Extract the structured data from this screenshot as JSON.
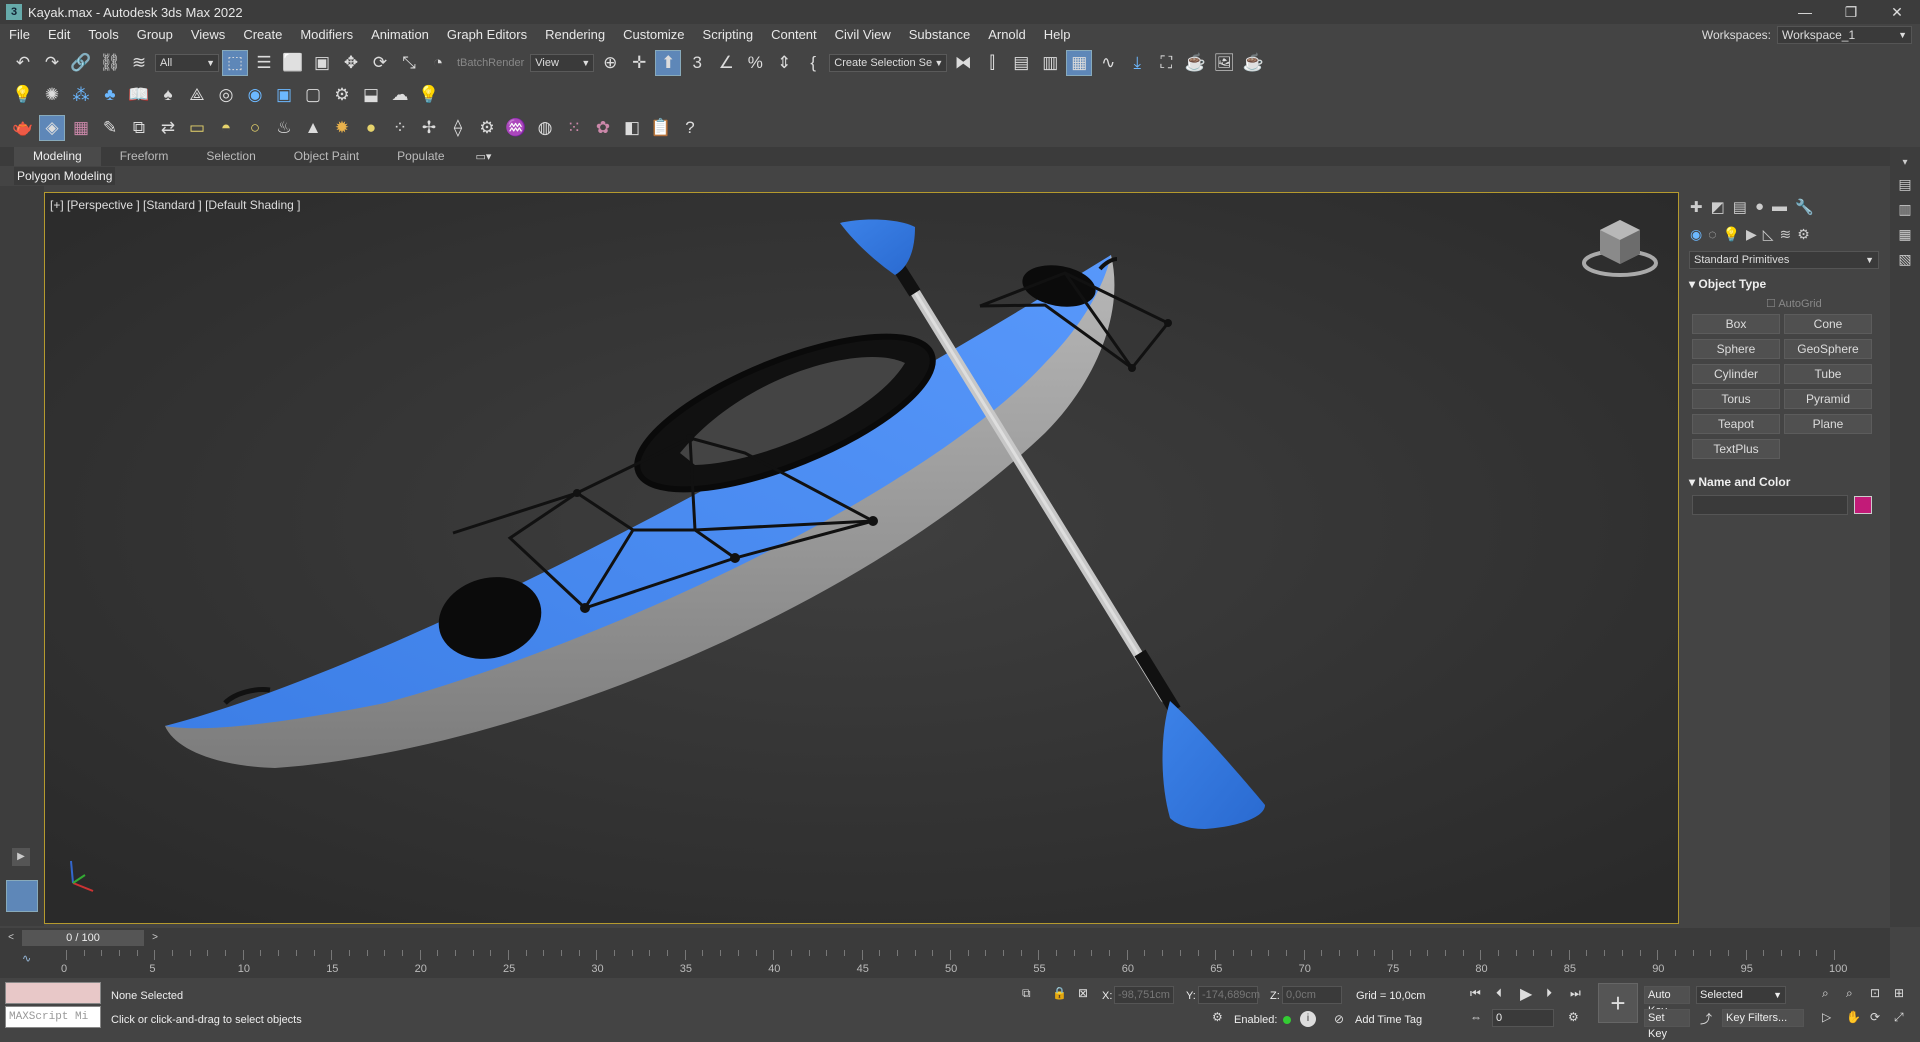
{
  "app": {
    "title": "Kayak.max - Autodesk 3ds Max 2022",
    "window_controls": [
      "—",
      "❐",
      "✕"
    ]
  },
  "menu": {
    "items": [
      "File",
      "Edit",
      "Tools",
      "Group",
      "Views",
      "Create",
      "Modifiers",
      "Animation",
      "Graph Editors",
      "Rendering",
      "Customize",
      "Scripting",
      "Content",
      "Civil View",
      "Substance",
      "Arnold",
      "Help"
    ],
    "workspaces_label": "Workspaces:",
    "workspace_value": "Workspace_1"
  },
  "toolbar": {
    "selection_filter": "All",
    "batch_render": "tBatchRender",
    "ref_coord": "View",
    "selection_set": "Create Selection Se"
  },
  "ribbon": {
    "tabs": [
      "Modeling",
      "Freeform",
      "Selection",
      "Object Paint",
      "Populate"
    ],
    "sub_label": "Polygon Modeling"
  },
  "viewport": {
    "label": "[+] [Perspective ] [Standard ] [Default Shading ]"
  },
  "command_panel": {
    "category": "Standard Primitives",
    "object_type_header": "Object Type",
    "autogrid": "AutoGrid",
    "buttons": [
      "Box",
      "Cone",
      "Sphere",
      "GeoSphere",
      "Cylinder",
      "Tube",
      "Torus",
      "Pyramid",
      "Teapot",
      "Plane",
      "TextPlus"
    ],
    "name_color_header": "Name and Color",
    "color": "#c21b78"
  },
  "timeline": {
    "frame": "0 / 100",
    "ticks": [
      "0",
      "5",
      "10",
      "15",
      "20",
      "25",
      "30",
      "35",
      "40",
      "45",
      "50",
      "55",
      "60",
      "65",
      "70",
      "75",
      "80",
      "85",
      "90",
      "95",
      "100"
    ]
  },
  "status": {
    "selection": "None Selected",
    "prompt": "Click or click-and-drag to select objects",
    "maxscript": "MAXScript Mi",
    "x_label": "X:",
    "x_value": "-98,751cm",
    "y_label": "Y:",
    "y_value": "-174,689cm",
    "z_label": "Z:",
    "z_value": "0,0cm",
    "grid": "Grid = 10,0cm",
    "enabled": "Enabled:",
    "add_time_tag": "Add Time Tag",
    "auto_key": "Auto Key",
    "set_key": "Set Key",
    "key_mode": "Selected",
    "key_filters": "Key Filters...",
    "frame_input": "0"
  }
}
